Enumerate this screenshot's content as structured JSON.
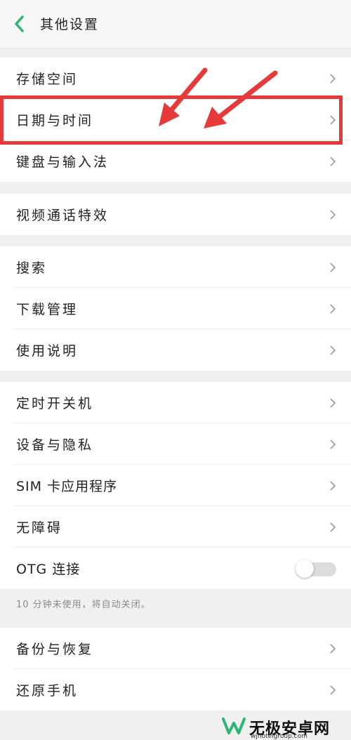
{
  "header": {
    "title": "其他设置"
  },
  "groups": [
    {
      "items": [
        {
          "label": "存储空间"
        },
        {
          "label": "日期与时间"
        },
        {
          "label": "键盘与输入法"
        }
      ]
    },
    {
      "items": [
        {
          "label": "视频通话特效"
        }
      ]
    },
    {
      "items": [
        {
          "label": "搜索"
        },
        {
          "label": "下载管理"
        },
        {
          "label": "使用说明"
        }
      ]
    },
    {
      "items": [
        {
          "label": "定时开关机"
        },
        {
          "label": "设备与隐私"
        },
        {
          "label": "SIM 卡应用程序"
        },
        {
          "label": "无障碍"
        },
        {
          "label": "OTG 连接",
          "toggle": false
        }
      ]
    },
    {
      "items": [
        {
          "label": "备份与恢复"
        },
        {
          "label": "还原手机"
        }
      ]
    }
  ],
  "otg_hint": "10 分钟未使用，将自动关闭。",
  "colors": {
    "accent_green": "#2bb673",
    "annotation_red": "#e63a3a"
  },
  "watermark": {
    "text": "无极安卓网",
    "url": "wjhotelgroup.com"
  }
}
